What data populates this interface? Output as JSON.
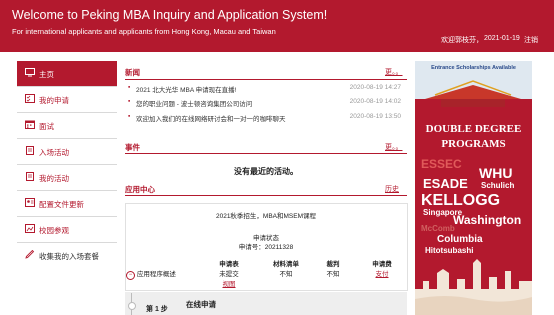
{
  "header": {
    "title": "Welcome to Peking MBA Inquiry and Application System!",
    "subtitle": "For international applicants and applicants from Hong Kong, Macau and Taiwan",
    "user": "欢迎郭枝芬，",
    "date": "2021-01-19",
    "logout": "注销"
  },
  "sidebar": {
    "items": [
      {
        "label": "主页",
        "icon": "monitor-icon"
      },
      {
        "label": "我的申请",
        "icon": "checklist-icon"
      },
      {
        "label": "面试",
        "icon": "calendar-icon"
      },
      {
        "label": "入场活动",
        "icon": "document-icon"
      },
      {
        "label": "我的活动",
        "icon": "document-icon"
      },
      {
        "label": "配置文件更新",
        "icon": "user-profile-icon"
      },
      {
        "label": "校园参观",
        "icon": "map-icon"
      },
      {
        "label": "收集我的入场套餐",
        "icon": "pencil-icon"
      }
    ]
  },
  "news": {
    "title": "新闻",
    "more": "更。。",
    "items": [
      {
        "text": "2021 北大光华 MBA 申请现在直播!",
        "date": "2020-08-19 14:27"
      },
      {
        "text": "您的职业问题 - 波士顿咨询集团公司访问",
        "date": "2020-08-19 14:02"
      },
      {
        "text": "欢迎加入我们的在线网络研讨会和一对一的咖啡聊天",
        "date": "2020-08-19 13:50"
      }
    ]
  },
  "events": {
    "title": "事件",
    "more": "更。。",
    "empty": "没有最近的活动。"
  },
  "application": {
    "title": "应用中心",
    "history": "历史",
    "program": "2021秋季招生，MBA和MSEM课程",
    "status_label": "申请状态",
    "app_number": "申请号：20211328",
    "overview": "应用程序概述",
    "columns": [
      {
        "header": "申请表",
        "line1": "未提交",
        "line2": "视图"
      },
      {
        "header": "材料清单",
        "line1": "不知",
        "line2": ""
      },
      {
        "header": "裁判",
        "line1": "不知",
        "line2": ""
      },
      {
        "header": "申请费",
        "line1": "支付",
        "line2": ""
      }
    ],
    "step": "第 1 步",
    "step_title": "在线申请"
  },
  "ad": {
    "banner": "Entrance Scholarships Available",
    "headline1": "DOUBLE DEGREE",
    "headline2": "PROGRAMS",
    "schools": [
      "ESSEC",
      "WHU",
      "ESADE",
      "Schulich",
      "KELLOGG",
      "Singapore",
      "Washington",
      "McComb",
      "Columbia",
      "Hitotsubashi"
    ]
  }
}
